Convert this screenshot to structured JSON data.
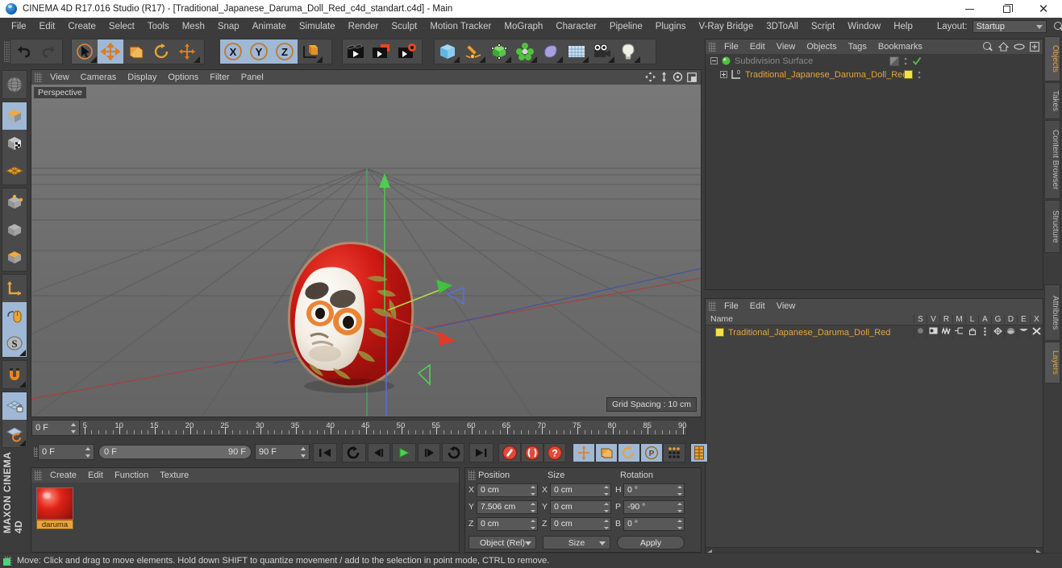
{
  "titlebar": {
    "title": "CINEMA 4D R17.016 Studio (R17) - [Traditional_Japanese_Daruma_Doll_Red_c4d_standart.c4d] - Main",
    "app_icon": "c4d-logo-icon",
    "minimize": "minimize-icon",
    "maximize": "restore-icon",
    "close": "✕"
  },
  "menubar": {
    "items": [
      "File",
      "Edit",
      "Create",
      "Select",
      "Tools",
      "Mesh",
      "Snap",
      "Animate",
      "Simulate",
      "Render",
      "Sculpt",
      "Motion Tracker",
      "MoGraph",
      "Character",
      "Pipeline",
      "Plugins",
      "V-Ray Bridge",
      "3DToAll",
      "Script",
      "Window",
      "Help"
    ],
    "layout_label": "Layout:",
    "layout_value": "Startup",
    "search_icon": "search-icon"
  },
  "toolbar": {
    "undo": "undo-icon",
    "redo": "redo-icon",
    "live_selection": "live-selection-icon",
    "move": "move-tool-icon",
    "scale": "scale-tool-icon",
    "rotate": "rotate-tool-icon",
    "move2": "move-axis-icon",
    "axis_x": "X",
    "axis_y": "Y",
    "axis_z": "Z",
    "world_object": "world-coordinate-icon",
    "render_view": "render-view-icon",
    "render_region": "render-region-icon",
    "render_settings": "render-settings-icon",
    "cube": "add-cube-icon",
    "spline": "add-spline-icon",
    "nurbs": "generator-icon",
    "array": "array-icon",
    "deformer": "deformer-icon",
    "environment": "environment-icon",
    "camera": "camera-icon",
    "light": "light-icon"
  },
  "lefttoolbar": {
    "items": [
      {
        "name": "viewport-globe-icon",
        "active": false
      },
      {
        "name": "model-mode-icon",
        "active": true
      },
      {
        "name": "texture-mode-icon",
        "active": false
      },
      {
        "name": "polygon-mesh-icon",
        "active": false
      },
      {
        "name": "point-mode-icon",
        "active": false
      },
      {
        "name": "edge-mode-icon",
        "active": false
      },
      {
        "name": "polygon-mode-icon",
        "active": false
      },
      {
        "name": "axis-mode-icon",
        "active": false
      },
      {
        "name": "enable-axis-icon",
        "active": true
      },
      {
        "name": "snap-icon",
        "active": true
      },
      {
        "name": "magnet-icon",
        "active": false
      },
      {
        "name": "lock-workplane-icon",
        "active": true
      },
      {
        "name": "workplane-rotate-icon",
        "active": false
      }
    ],
    "brand": "MAXON CINEMA 4D"
  },
  "viewport": {
    "menus": [
      "View",
      "Cameras",
      "Display",
      "Options",
      "Filter",
      "Panel"
    ],
    "perspective_label": "Perspective",
    "grid_spacing": "Grid Spacing : 10 cm",
    "nav_icons": [
      "pan-icon",
      "dolly-icon",
      "rotate-view-icon",
      "maximize-panel-icon"
    ],
    "axis_gizmo": {
      "x": "X",
      "y": "Y",
      "z": "Z"
    }
  },
  "object_manager": {
    "menus": [
      "File",
      "Edit",
      "View",
      "Objects",
      "Tags",
      "Bookmarks"
    ],
    "icons": [
      "search-icon",
      "home-icon",
      "link-icon",
      "new-layer-icon"
    ],
    "tree": [
      {
        "label": "Subdivision Surface",
        "selected": false,
        "dimmed": true,
        "icon": "subdivision-surface-icon"
      },
      {
        "label": "Traditional_Japanese_Daruma_Doll_Red",
        "selected": true,
        "dimmed": false,
        "icon": "polygon-object-icon",
        "tag": "yellow-material-tag"
      }
    ]
  },
  "layer_manager": {
    "menus": [
      "File",
      "Edit",
      "View"
    ],
    "name_header": "Name",
    "columns": [
      "S",
      "V",
      "R",
      "M",
      "L",
      "A",
      "G",
      "D",
      "E",
      "X"
    ],
    "rows": [
      {
        "label": "Traditional_Japanese_Daruma_Doll_Red",
        "swatch": "yellow-layer-swatch"
      }
    ]
  },
  "right_tabs": {
    "top": [
      {
        "label": "Objects",
        "active": true
      },
      {
        "label": "Takes",
        "active": false
      },
      {
        "label": "Content Browser",
        "active": false
      },
      {
        "label": "Structure",
        "active": false
      }
    ],
    "bottom": [
      {
        "label": "Attributes",
        "active": false
      },
      {
        "label": "Layers",
        "active": true
      }
    ]
  },
  "timeline": {
    "ticks": [
      0,
      5,
      10,
      15,
      20,
      25,
      30,
      35,
      40,
      45,
      50,
      55,
      60,
      65,
      70,
      75,
      80,
      85,
      90
    ],
    "start": 0,
    "end": 90,
    "playhead": 0,
    "current_frame_field": "0 F"
  },
  "transport": {
    "current_frame": "0 F",
    "range_start": "0 F",
    "range_end": "90 F",
    "end_frame": "90 F",
    "buttons": [
      {
        "name": "go-to-start-button",
        "icon": "skip-start-icon",
        "active": false
      },
      {
        "name": "loop-button",
        "icon": "loop-icon",
        "active": false
      },
      {
        "name": "step-back-button",
        "icon": "step-back-icon",
        "active": false
      },
      {
        "name": "play-button",
        "icon": "play-icon",
        "active": false
      },
      {
        "name": "step-forward-button",
        "icon": "step-forward-icon",
        "active": false
      },
      {
        "name": "play-reverse-button",
        "icon": "loop-reverse-icon",
        "active": false
      },
      {
        "name": "go-to-end-button",
        "icon": "skip-end-icon",
        "active": false
      }
    ],
    "record_buttons": [
      {
        "name": "record-keyframe-button",
        "icon": "record-icon"
      },
      {
        "name": "autokeying-button",
        "icon": "autokey-icon"
      },
      {
        "name": "keyframe-selection-button",
        "icon": "key-selection-icon"
      }
    ],
    "param_buttons": [
      {
        "name": "position-key-button",
        "icon": "position-icon",
        "active": true
      },
      {
        "name": "scale-key-button",
        "icon": "scale-icon",
        "active": true
      },
      {
        "name": "rotation-key-button",
        "icon": "rotation-icon",
        "active": true
      },
      {
        "name": "pla-key-button",
        "icon": "point-level-animation-icon",
        "active": true
      },
      {
        "name": "parameter-key-button",
        "icon": "parameter-icon",
        "active": false
      },
      {
        "name": "timeline-button",
        "icon": "timeline-icon",
        "active": true
      }
    ]
  },
  "material_manager": {
    "menus": [
      "Create",
      "Edit",
      "Function",
      "Texture"
    ],
    "materials": [
      {
        "name": "daruma",
        "preview": "red-sphere-material"
      }
    ]
  },
  "coordinates": {
    "headers": [
      "Position",
      "Size",
      "Rotation"
    ],
    "position": {
      "labels": [
        "X",
        "Y",
        "Z"
      ],
      "values": [
        "0 cm",
        "7.506 cm",
        "0 cm"
      ]
    },
    "size": {
      "labels": [
        "X",
        "Y",
        "Z"
      ],
      "values": [
        "0 cm",
        "0 cm",
        "0 cm"
      ]
    },
    "rotation": {
      "labels": [
        "H",
        "P",
        "B"
      ],
      "values": [
        "0 °",
        "-90 °",
        "0 °"
      ]
    },
    "mode_dropdown": "Object (Rel)",
    "size_dropdown": "Size",
    "apply_button": "Apply"
  },
  "statusbar": {
    "message": "Move: Click and drag to move elements. Hold down SHIFT to quantize movement / add to the selection in point mode, CTRL to remove."
  }
}
